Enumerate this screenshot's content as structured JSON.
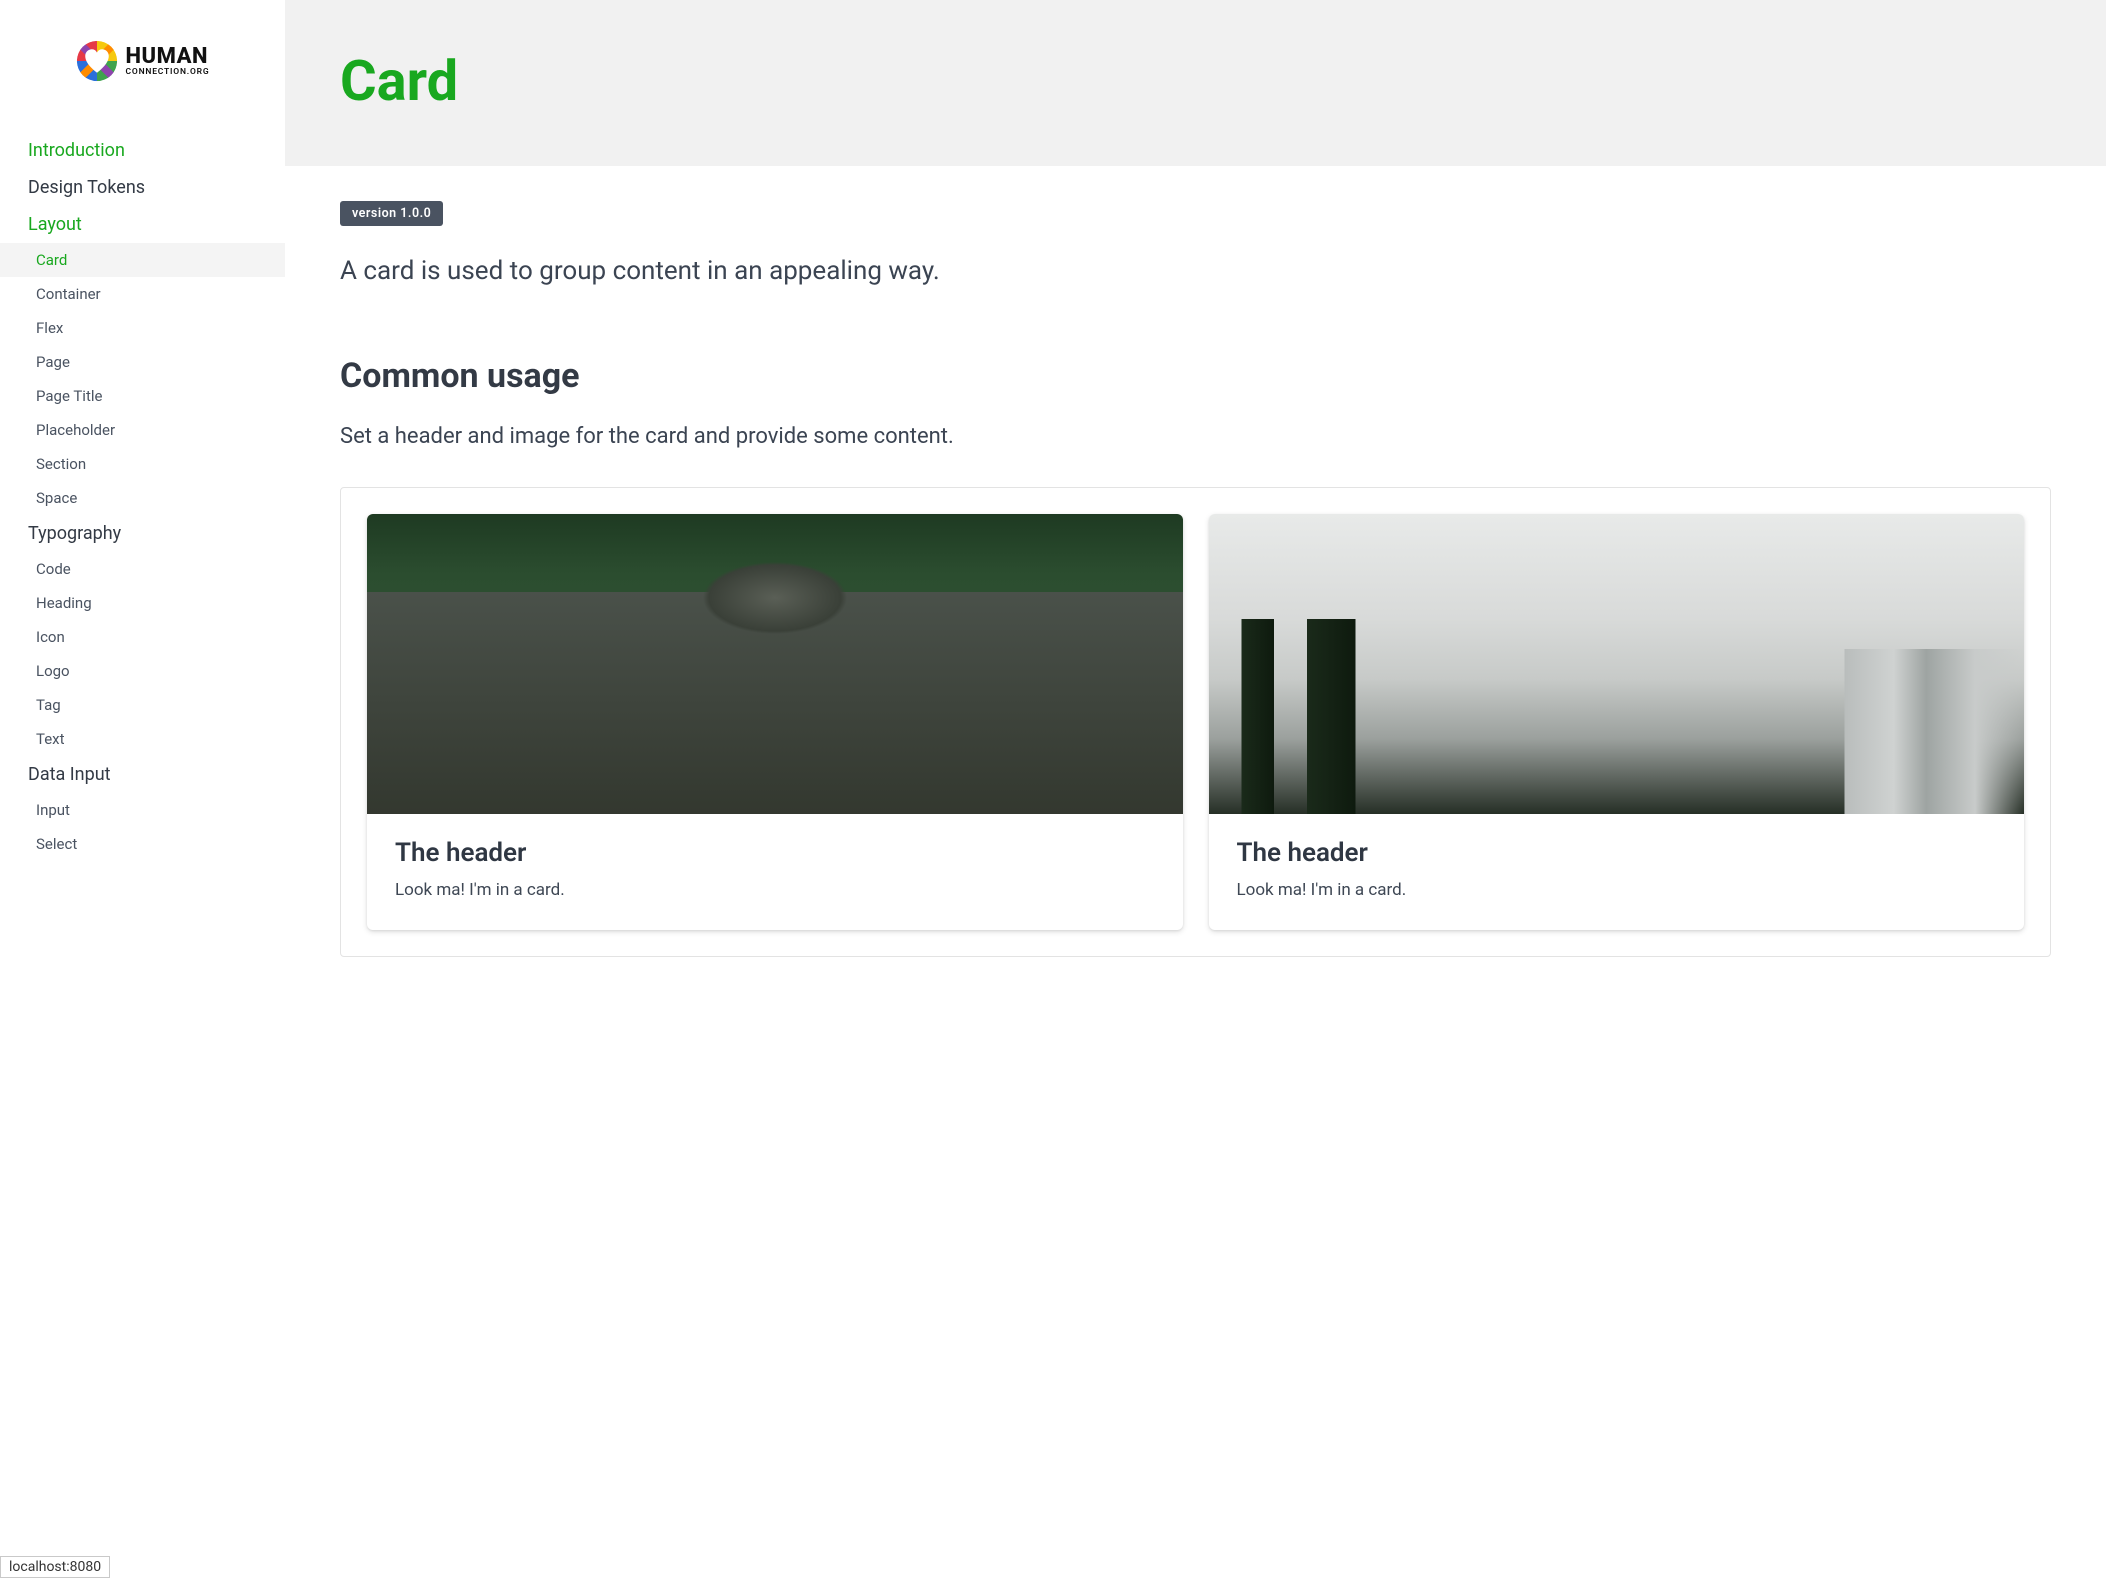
{
  "logo": {
    "primary": "HUMAN",
    "secondary": "CONNECTION.ORG"
  },
  "nav": {
    "introduction": "Introduction",
    "design_tokens": "Design Tokens",
    "layout": {
      "label": "Layout",
      "items": [
        "Card",
        "Container",
        "Flex",
        "Page",
        "Page Title",
        "Placeholder",
        "Section",
        "Space"
      ]
    },
    "typography": {
      "label": "Typography",
      "items": [
        "Code",
        "Heading",
        "Icon",
        "Logo",
        "Tag",
        "Text"
      ]
    },
    "data_input": {
      "label": "Data Input",
      "items": [
        "Input",
        "Select"
      ]
    }
  },
  "page": {
    "title": "Card",
    "version_badge": "version 1.0.0",
    "lead": "A card is used to group content in an appealing way.",
    "section_title": "Common usage",
    "section_desc": "Set a header and image for the card and provide some content."
  },
  "cards": [
    {
      "header": "The header",
      "body": "Look ma! I'm in a card."
    },
    {
      "header": "The header",
      "body": "Look ma! I'm in a card."
    }
  ],
  "status": "localhost:8080"
}
